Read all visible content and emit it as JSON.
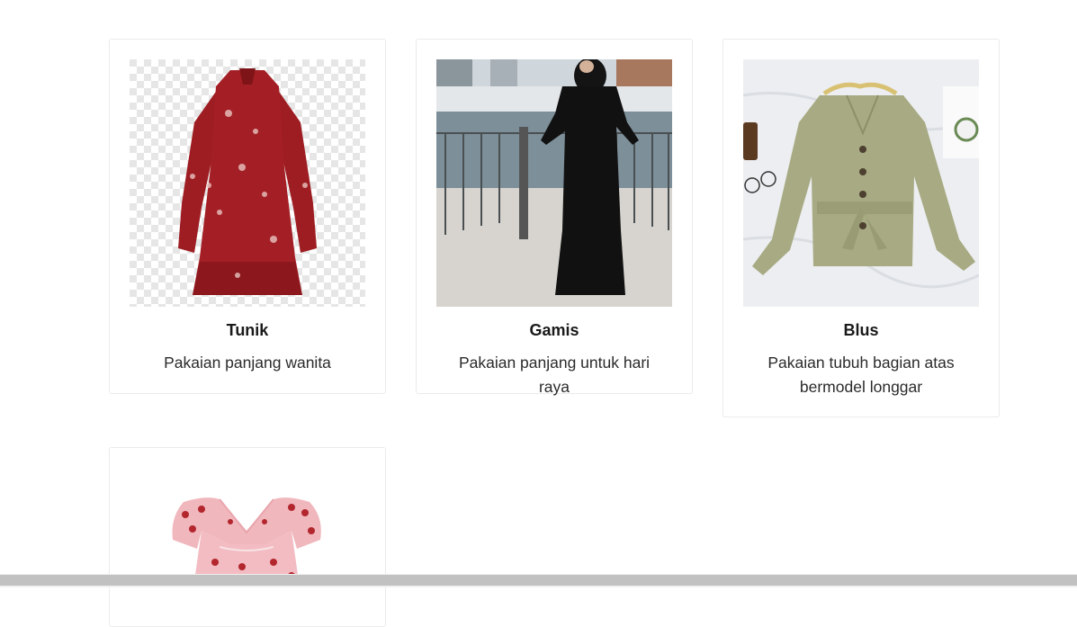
{
  "products": [
    {
      "name": "Tunik",
      "description": "Pakaian panjang wanita",
      "image": "red-floral-tunic-photo"
    },
    {
      "name": "Gamis",
      "description": "Pakaian panjang untuk hari raya",
      "image": "black-gamis-photo"
    },
    {
      "name": "Blus",
      "description": "Pakaian tubuh bagian atas bermodel longgar",
      "image": "olive-blouse-photo"
    },
    {
      "name": "",
      "description": "",
      "image": "pink-strawberry-dress-photo"
    }
  ],
  "colors": {
    "card_border": "#ebebeb",
    "title": "#1a1a1a",
    "text": "#2b2b2b",
    "scrollbar_thumb": "#c1c1c1"
  }
}
